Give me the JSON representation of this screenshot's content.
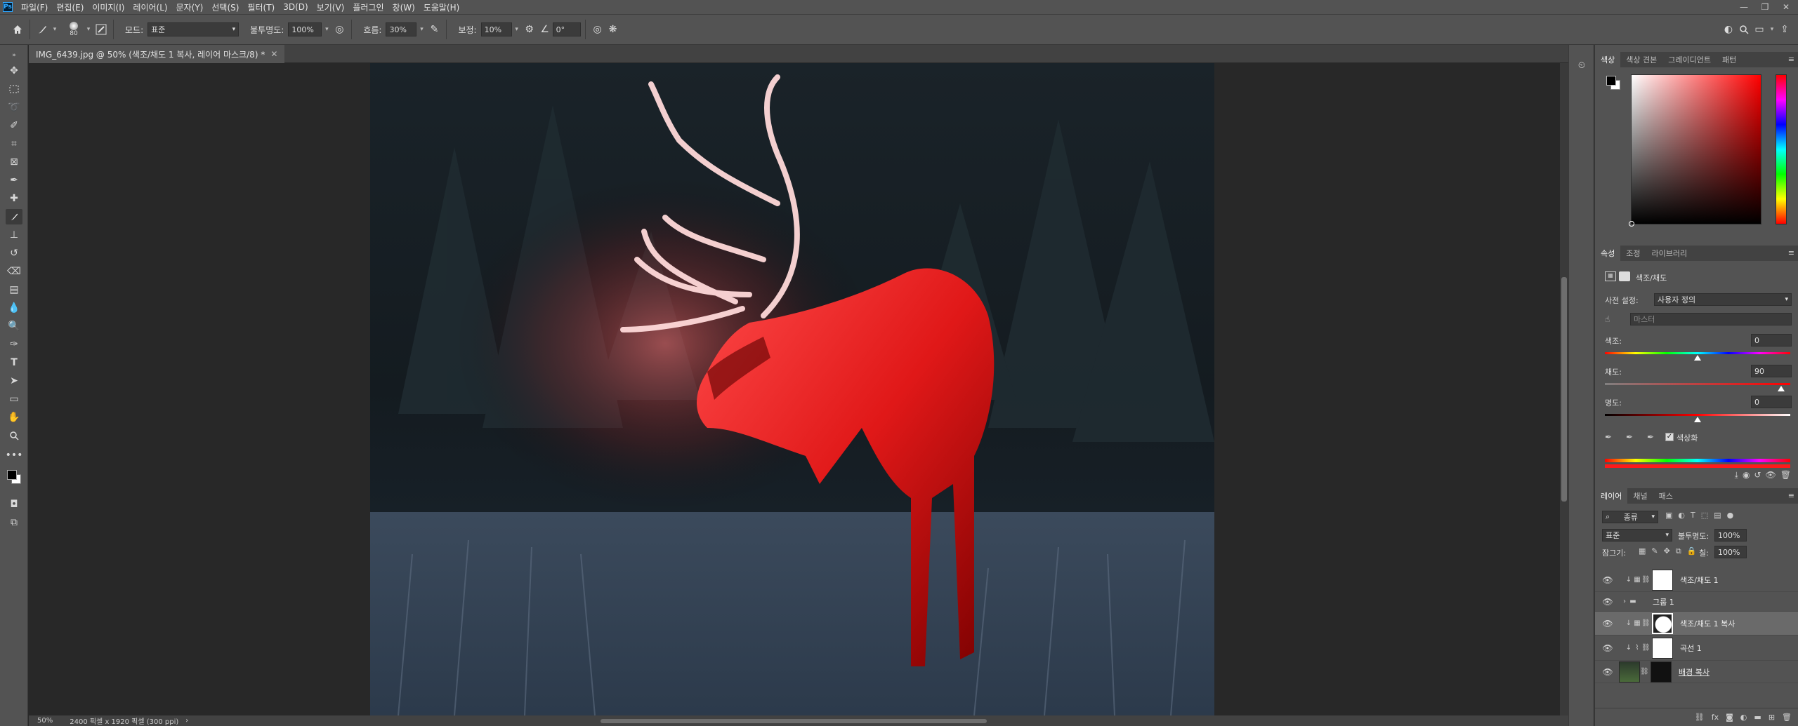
{
  "app": {
    "logo": "Ps"
  },
  "menu": [
    "파일(F)",
    "편집(E)",
    "이미지(I)",
    "레이어(L)",
    "문자(Y)",
    "선택(S)",
    "필터(T)",
    "3D(D)",
    "보기(V)",
    "플러그인",
    "창(W)",
    "도움말(H)"
  ],
  "window_controls": [
    "—",
    "❐",
    "✕"
  ],
  "options": {
    "brush_size": "80",
    "mode_label": "모드:",
    "mode_value": "표준",
    "opacity_label": "불투명도:",
    "opacity_value": "100%",
    "flow_label": "흐름:",
    "flow_value": "30%",
    "smoothing_label": "보정:",
    "smoothing_value": "10%",
    "angle_value": "0°"
  },
  "document": {
    "tab_title": "IMG_6439.jpg @ 50% (색조/채도 1 복사, 레이어 마스크/8) *",
    "zoom": "50%",
    "dimensions": "2400 픽셀 x 1920 픽셀 (300 ppi)"
  },
  "color_panel": {
    "tabs": [
      "색상",
      "색상 견본",
      "그레이디언트",
      "패턴"
    ],
    "foreground": "#000000",
    "background": "#ffffff",
    "hue_color": "#ff0000"
  },
  "properties_panel": {
    "tabs": [
      "속성",
      "조정",
      "라이브러리"
    ],
    "adjustment_title": "색조/채도",
    "preset_label": "사전 설정:",
    "preset_value": "사용자 정의",
    "channel_value": "마스터",
    "hue_label": "색조:",
    "hue_value": "0",
    "saturation_label": "채도:",
    "saturation_value": "90",
    "lightness_label": "명도:",
    "lightness_value": "0",
    "colorize_label": "색상화",
    "colorize_checked": true
  },
  "layers_panel": {
    "tabs": [
      "레이어",
      "채널",
      "패스"
    ],
    "filter_value": "종류",
    "blend_mode": "표준",
    "opacity_label": "불투명도:",
    "opacity_value": "100%",
    "lock_label": "잠그기:",
    "fill_label": "칠:",
    "fill_value": "100%",
    "layers": [
      {
        "name": "색조/채도 1",
        "type": "adjustment"
      },
      {
        "name": "그룹 1",
        "type": "group"
      },
      {
        "name": "색조/채도 1 복사",
        "type": "adjustment",
        "selected": true
      },
      {
        "name": "곡선 1",
        "type": "curves"
      },
      {
        "name": "배경 복사",
        "type": "image"
      }
    ]
  },
  "icons": {
    "move": "move-icon",
    "marquee": "marquee-icon",
    "lasso": "lasso-icon",
    "brush": "brush-icon",
    "text": "T",
    "zoom": "zoom-icon",
    "hand": "hand-icon"
  }
}
